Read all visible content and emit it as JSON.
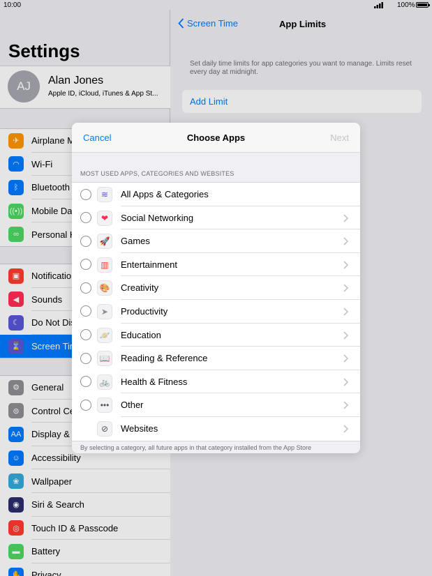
{
  "status_bar": {
    "time": "10:00",
    "battery": "100%"
  },
  "settings": {
    "title": "Settings",
    "profile": {
      "initials": "AJ",
      "name": "Alan Jones",
      "subtitle": "Apple ID, iCloud, iTunes & App St..."
    },
    "groups": [
      [
        {
          "label": "Airplane M",
          "color": "#ff9500",
          "icon": "airplane-icon",
          "glyph": "✈"
        },
        {
          "label": "Wi-Fi",
          "color": "#007aff",
          "icon": "wifi-icon",
          "glyph": "◠"
        },
        {
          "label": "Bluetooth",
          "color": "#007aff",
          "icon": "bluetooth-icon",
          "glyph": "ᛒ"
        },
        {
          "label": "Mobile Da",
          "color": "#4cd964",
          "icon": "antenna-icon",
          "glyph": "((•))"
        },
        {
          "label": "Personal H",
          "color": "#4cd964",
          "icon": "hotspot-icon",
          "glyph": "∞"
        }
      ],
      [
        {
          "label": "Notificatio",
          "color": "#ff3b30",
          "icon": "notifications-icon",
          "glyph": "▣"
        },
        {
          "label": "Sounds",
          "color": "#ff2d55",
          "icon": "speaker-icon",
          "glyph": "◀"
        },
        {
          "label": "Do Not Dis",
          "color": "#5856d6",
          "icon": "moon-icon",
          "glyph": "☾"
        },
        {
          "label": "Screen Tim",
          "color": "#5856d6",
          "icon": "hourglass-icon",
          "glyph": "⌛",
          "selected": true
        }
      ],
      [
        {
          "label": "General",
          "color": "#8e8e93",
          "icon": "gear-icon",
          "glyph": "⚙"
        },
        {
          "label": "Control Ce",
          "color": "#8e8e93",
          "icon": "toggles-icon",
          "glyph": "⊜"
        },
        {
          "label": "Display &",
          "color": "#007aff",
          "icon": "text-size-icon",
          "glyph": "AA"
        },
        {
          "label": "Accessibility",
          "color": "#007aff",
          "icon": "accessibility-icon",
          "glyph": "☺"
        },
        {
          "label": "Wallpaper",
          "color": "#34aadc",
          "icon": "flower-icon",
          "glyph": "❀"
        },
        {
          "label": "Siri & Search",
          "color": "#2c2c6e",
          "icon": "siri-icon",
          "glyph": "◉"
        },
        {
          "label": "Touch ID & Passcode",
          "color": "#ff3b30",
          "icon": "fingerprint-icon",
          "glyph": "◎"
        },
        {
          "label": "Battery",
          "color": "#4cd964",
          "icon": "battery-icon",
          "glyph": "▬"
        },
        {
          "label": "Privacy",
          "color": "#007aff",
          "icon": "hand-icon",
          "glyph": "✋"
        }
      ]
    ]
  },
  "detail": {
    "back_label": "Screen Time",
    "title": "App Limits",
    "description": "Set daily time limits for app categories you want to manage. Limits reset every day at midnight.",
    "add_limit": "Add Limit"
  },
  "modal": {
    "cancel": "Cancel",
    "title": "Choose Apps",
    "next": "Next",
    "section_header": "MOST USED APPS, CATEGORIES AND WEBSITES",
    "items": [
      {
        "label": "All Apps & Categories",
        "icon": "stack-icon",
        "glyph": "≋",
        "radio": true,
        "chevron": false,
        "glyph_color": "#5856d6"
      },
      {
        "label": "Social Networking",
        "icon": "chat-heart-icon",
        "glyph": "❤",
        "radio": true,
        "chevron": true,
        "glyph_color": "#ff2d55"
      },
      {
        "label": "Games",
        "icon": "rocket-icon",
        "glyph": "🚀",
        "radio": true,
        "chevron": true,
        "glyph_color": "#34aadc"
      },
      {
        "label": "Entertainment",
        "icon": "popcorn-icon",
        "glyph": "▥",
        "radio": true,
        "chevron": true,
        "glyph_color": "#ff3b30"
      },
      {
        "label": "Creativity",
        "icon": "palette-icon",
        "glyph": "🎨",
        "radio": true,
        "chevron": true,
        "glyph_color": "#ff9500"
      },
      {
        "label": "Productivity",
        "icon": "paper-plane-icon",
        "glyph": "➤",
        "radio": true,
        "chevron": true,
        "glyph_color": "#8e8e93"
      },
      {
        "label": "Education",
        "icon": "planet-icon",
        "glyph": "🪐",
        "radio": true,
        "chevron": true,
        "glyph_color": "#ff9500"
      },
      {
        "label": "Reading & Reference",
        "icon": "book-icon",
        "glyph": "📖",
        "radio": true,
        "chevron": true,
        "glyph_color": "#007aff"
      },
      {
        "label": "Health & Fitness",
        "icon": "bicycle-icon",
        "glyph": "🚲",
        "radio": true,
        "chevron": true,
        "glyph_color": "#007aff"
      },
      {
        "label": "Other",
        "icon": "ellipsis-icon",
        "glyph": "•••",
        "radio": true,
        "chevron": true,
        "glyph_color": "#555"
      },
      {
        "label": "Websites",
        "icon": "compass-icon",
        "glyph": "⊘",
        "radio": false,
        "chevron": true,
        "glyph_color": "#555"
      }
    ],
    "footnote": "By selecting a category, all future apps in that category installed from the App Store"
  }
}
